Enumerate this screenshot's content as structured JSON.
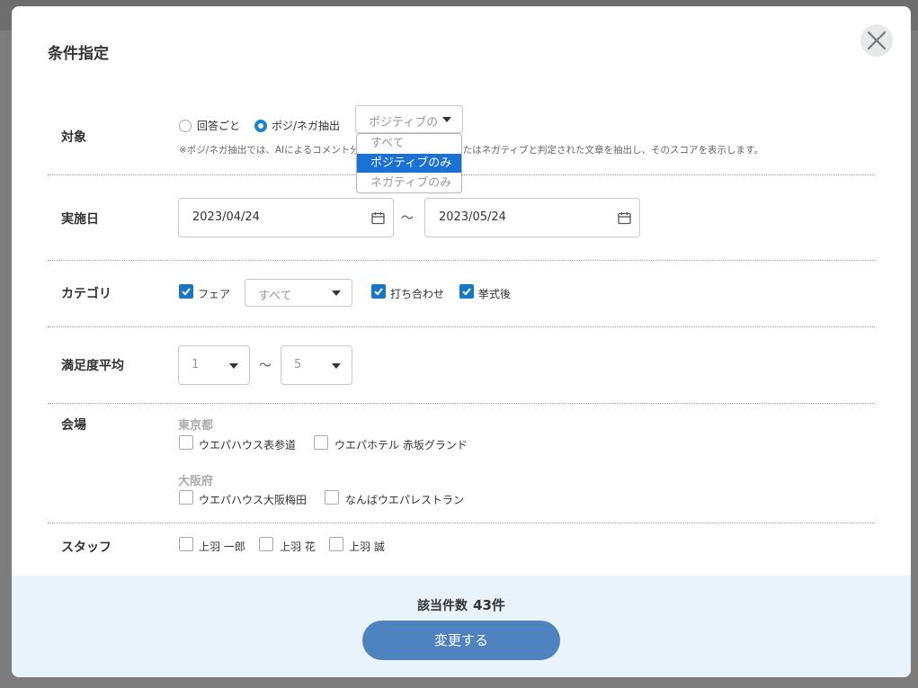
{
  "modal": {
    "title": "条件指定"
  },
  "target": {
    "label": "対象",
    "options": [
      {
        "label": "回答ごと",
        "checked": false
      },
      {
        "label": "ポジ/ネガ抽出",
        "checked": true
      }
    ],
    "select_value": "ポジティブの",
    "note": "※ポジ/ネガ抽出では、AIによるコメント分析を行い、ポジティブまたはネガティブと判定された文章を抽出し、そのスコアを表示します。",
    "dropdown_options": [
      "すべて",
      "ポジティブのみ",
      "ネガティブのみ"
    ],
    "dropdown_selected": "ポジティブのみ"
  },
  "date": {
    "label": "実施日",
    "from": "2023/04/24",
    "to": "2023/05/24",
    "separator": "〜"
  },
  "category": {
    "label": "カテゴリ",
    "items": [
      {
        "label": "フェア",
        "checked": true
      },
      {
        "label": "打ち合わせ",
        "checked": true
      },
      {
        "label": "挙式後",
        "checked": true
      }
    ],
    "fair_select": "すべて"
  },
  "satisfaction": {
    "label": "満足度平均",
    "min": "1",
    "max": "5",
    "separator": "〜"
  },
  "venue": {
    "label": "会場",
    "groups": [
      {
        "name": "東京都",
        "items": [
          "ウエパハウス表参道",
          "ウエパホテル 赤坂グランド"
        ]
      },
      {
        "name": "大阪府",
        "items": [
          "ウエパハウス大阪梅田",
          "なんばウエパレストラン"
        ]
      }
    ]
  },
  "staff": {
    "label": "スタッフ",
    "items": [
      "上羽 一郎",
      "上羽 花",
      "上羽 誠"
    ]
  },
  "footer": {
    "count_label": "該当件数",
    "count_value": "43件",
    "submit_label": "変更する"
  },
  "colors": {
    "accent": "#1976c5",
    "button": "#4f83bf",
    "footer_bg": "#e8f3fb",
    "dropdown_selected": "#1a72d4"
  }
}
